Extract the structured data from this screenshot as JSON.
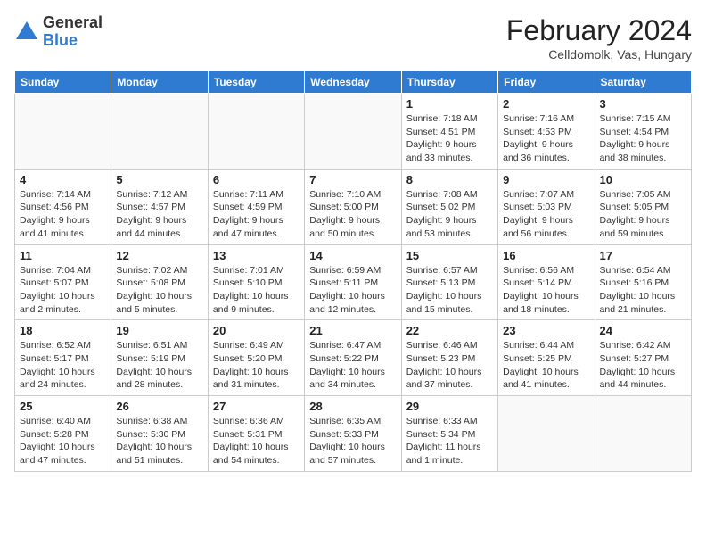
{
  "logo": {
    "general": "General",
    "blue": "Blue"
  },
  "title": "February 2024",
  "subtitle": "Celldomolk, Vas, Hungary",
  "weekdays": [
    "Sunday",
    "Monday",
    "Tuesday",
    "Wednesday",
    "Thursday",
    "Friday",
    "Saturday"
  ],
  "weeks": [
    [
      {
        "day": "",
        "info": ""
      },
      {
        "day": "",
        "info": ""
      },
      {
        "day": "",
        "info": ""
      },
      {
        "day": "",
        "info": ""
      },
      {
        "day": "1",
        "info": "Sunrise: 7:18 AM\nSunset: 4:51 PM\nDaylight: 9 hours\nand 33 minutes."
      },
      {
        "day": "2",
        "info": "Sunrise: 7:16 AM\nSunset: 4:53 PM\nDaylight: 9 hours\nand 36 minutes."
      },
      {
        "day": "3",
        "info": "Sunrise: 7:15 AM\nSunset: 4:54 PM\nDaylight: 9 hours\nand 38 minutes."
      }
    ],
    [
      {
        "day": "4",
        "info": "Sunrise: 7:14 AM\nSunset: 4:56 PM\nDaylight: 9 hours\nand 41 minutes."
      },
      {
        "day": "5",
        "info": "Sunrise: 7:12 AM\nSunset: 4:57 PM\nDaylight: 9 hours\nand 44 minutes."
      },
      {
        "day": "6",
        "info": "Sunrise: 7:11 AM\nSunset: 4:59 PM\nDaylight: 9 hours\nand 47 minutes."
      },
      {
        "day": "7",
        "info": "Sunrise: 7:10 AM\nSunset: 5:00 PM\nDaylight: 9 hours\nand 50 minutes."
      },
      {
        "day": "8",
        "info": "Sunrise: 7:08 AM\nSunset: 5:02 PM\nDaylight: 9 hours\nand 53 minutes."
      },
      {
        "day": "9",
        "info": "Sunrise: 7:07 AM\nSunset: 5:03 PM\nDaylight: 9 hours\nand 56 minutes."
      },
      {
        "day": "10",
        "info": "Sunrise: 7:05 AM\nSunset: 5:05 PM\nDaylight: 9 hours\nand 59 minutes."
      }
    ],
    [
      {
        "day": "11",
        "info": "Sunrise: 7:04 AM\nSunset: 5:07 PM\nDaylight: 10 hours\nand 2 minutes."
      },
      {
        "day": "12",
        "info": "Sunrise: 7:02 AM\nSunset: 5:08 PM\nDaylight: 10 hours\nand 5 minutes."
      },
      {
        "day": "13",
        "info": "Sunrise: 7:01 AM\nSunset: 5:10 PM\nDaylight: 10 hours\nand 9 minutes."
      },
      {
        "day": "14",
        "info": "Sunrise: 6:59 AM\nSunset: 5:11 PM\nDaylight: 10 hours\nand 12 minutes."
      },
      {
        "day": "15",
        "info": "Sunrise: 6:57 AM\nSunset: 5:13 PM\nDaylight: 10 hours\nand 15 minutes."
      },
      {
        "day": "16",
        "info": "Sunrise: 6:56 AM\nSunset: 5:14 PM\nDaylight: 10 hours\nand 18 minutes."
      },
      {
        "day": "17",
        "info": "Sunrise: 6:54 AM\nSunset: 5:16 PM\nDaylight: 10 hours\nand 21 minutes."
      }
    ],
    [
      {
        "day": "18",
        "info": "Sunrise: 6:52 AM\nSunset: 5:17 PM\nDaylight: 10 hours\nand 24 minutes."
      },
      {
        "day": "19",
        "info": "Sunrise: 6:51 AM\nSunset: 5:19 PM\nDaylight: 10 hours\nand 28 minutes."
      },
      {
        "day": "20",
        "info": "Sunrise: 6:49 AM\nSunset: 5:20 PM\nDaylight: 10 hours\nand 31 minutes."
      },
      {
        "day": "21",
        "info": "Sunrise: 6:47 AM\nSunset: 5:22 PM\nDaylight: 10 hours\nand 34 minutes."
      },
      {
        "day": "22",
        "info": "Sunrise: 6:46 AM\nSunset: 5:23 PM\nDaylight: 10 hours\nand 37 minutes."
      },
      {
        "day": "23",
        "info": "Sunrise: 6:44 AM\nSunset: 5:25 PM\nDaylight: 10 hours\nand 41 minutes."
      },
      {
        "day": "24",
        "info": "Sunrise: 6:42 AM\nSunset: 5:27 PM\nDaylight: 10 hours\nand 44 minutes."
      }
    ],
    [
      {
        "day": "25",
        "info": "Sunrise: 6:40 AM\nSunset: 5:28 PM\nDaylight: 10 hours\nand 47 minutes."
      },
      {
        "day": "26",
        "info": "Sunrise: 6:38 AM\nSunset: 5:30 PM\nDaylight: 10 hours\nand 51 minutes."
      },
      {
        "day": "27",
        "info": "Sunrise: 6:36 AM\nSunset: 5:31 PM\nDaylight: 10 hours\nand 54 minutes."
      },
      {
        "day": "28",
        "info": "Sunrise: 6:35 AM\nSunset: 5:33 PM\nDaylight: 10 hours\nand 57 minutes."
      },
      {
        "day": "29",
        "info": "Sunrise: 6:33 AM\nSunset: 5:34 PM\nDaylight: 11 hours\nand 1 minute."
      },
      {
        "day": "",
        "info": ""
      },
      {
        "day": "",
        "info": ""
      }
    ]
  ]
}
